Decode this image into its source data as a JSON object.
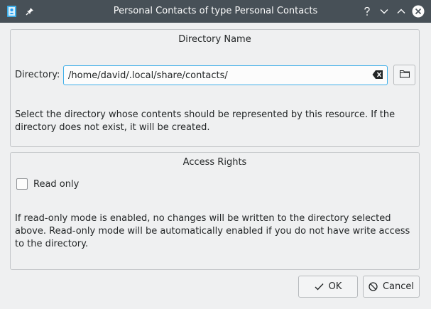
{
  "window": {
    "title": "Personal Contacts of type Personal Contacts",
    "app_icon": "address-book-icon",
    "controls": [
      "pin-icon",
      "help-icon",
      "minimize-icon",
      "maximize-icon",
      "close-icon"
    ]
  },
  "directory_group": {
    "title": "Directory Name",
    "label": "Directory:",
    "value": "/home/david/.local/share/contacts/",
    "description": "Select the directory whose contents should be represented by this resource. If the directory does not exist, it will be created."
  },
  "access_group": {
    "title": "Access Rights",
    "readonly_label": "Read only",
    "readonly_checked": false,
    "description": "If read-only mode is enabled, no changes will be written to the directory selected above. Read-only mode will be automatically enabled if you do not have write access to the directory."
  },
  "buttons": {
    "ok": "OK",
    "cancel": "Cancel"
  },
  "colors": {
    "titlebar": "#475057",
    "focus": "#3daee9",
    "background": "#eff0f1"
  }
}
